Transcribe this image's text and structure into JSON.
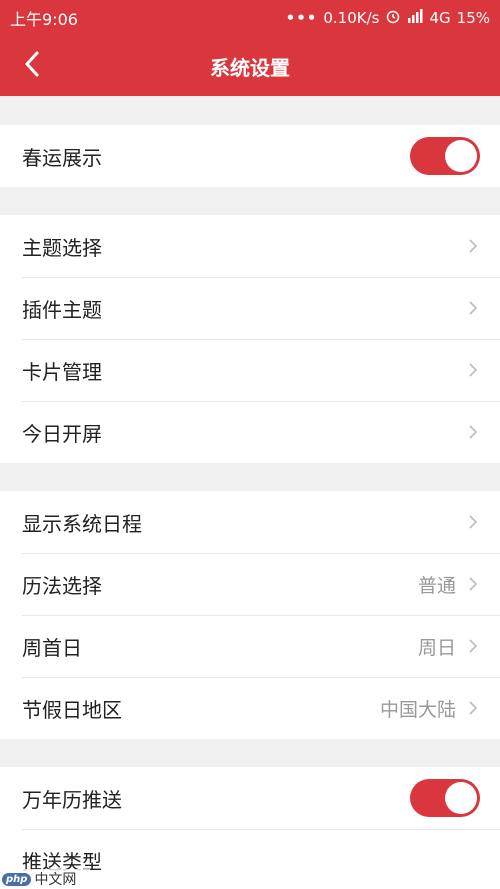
{
  "status_bar": {
    "time": "上午9:06",
    "net_speed": "0.10K/s",
    "network": "4G",
    "battery": "15%"
  },
  "header": {
    "title": "系统设置",
    "back_icon": "chevron-left-icon"
  },
  "groups": [
    {
      "items": [
        {
          "label": "春运展示",
          "toggle_on": true
        }
      ]
    },
    {
      "items": [
        {
          "label": "主题选择"
        },
        {
          "label": "插件主题"
        },
        {
          "label": "卡片管理"
        },
        {
          "label": "今日开屏"
        }
      ]
    },
    {
      "items": [
        {
          "label": "显示系统日程"
        },
        {
          "label": "历法选择",
          "value": "普通"
        },
        {
          "label": "周首日",
          "value": "周日"
        },
        {
          "label": "节假日地区",
          "value": "中国大陆"
        }
      ]
    },
    {
      "items": [
        {
          "label": "万年历推送",
          "toggle_on": true
        },
        {
          "label": "推送类型"
        }
      ]
    }
  ],
  "watermark": {
    "badge": "php",
    "text": "中文网"
  },
  "colors": {
    "accent": "#d9363e",
    "background": "#f0f0f0"
  }
}
